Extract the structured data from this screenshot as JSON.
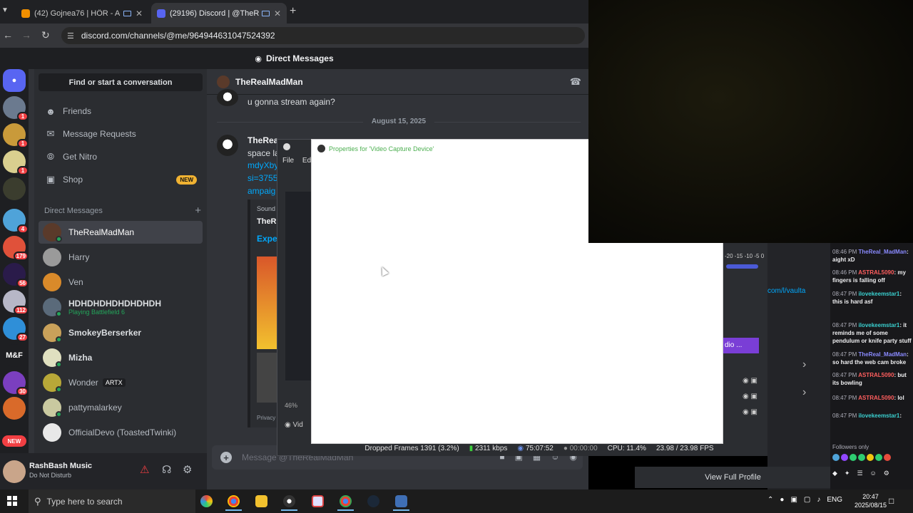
{
  "browser": {
    "tabs": [
      {
        "label": "(42) Gojnea76 | HÖR - Aug",
        "active": false,
        "favicon_color": "#f29000"
      },
      {
        "label": "(29196) Discord | @TheRea",
        "active": true,
        "favicon_color": "#5865f2"
      }
    ],
    "url": "discord.com/channels/@me/964944631047524392"
  },
  "discord": {
    "title": "Direct Messages",
    "find_placeholder": "Find or start a conversation",
    "nav": [
      {
        "label": "Friends",
        "icon": "person-wave-icon"
      },
      {
        "label": "Message Requests",
        "icon": "envelope-icon"
      },
      {
        "label": "Get Nitro",
        "icon": "nitro-icon"
      },
      {
        "label": "Shop",
        "icon": "shop-icon",
        "badge": "NEW"
      }
    ],
    "servers": [
      {
        "badge": "1"
      },
      {
        "badge": "1"
      },
      {
        "badge": "1"
      },
      {
        "badge": ""
      },
      {
        "badge": "4"
      },
      {
        "badge": "179"
      },
      {
        "badge": "56"
      },
      {
        "badge": "112"
      },
      {
        "badge": "27"
      },
      {
        "label": "M&F",
        "badge": ""
      },
      {
        "badge": "30"
      },
      {
        "badge": ""
      }
    ],
    "server_new_label": "NEW",
    "dm_header": "Direct Messages",
    "dms": [
      {
        "name": "TheRealMadMan",
        "active": true
      },
      {
        "name": "Harry"
      },
      {
        "name": "Ven"
      },
      {
        "name": "HDHDHDHDHDHDHDH",
        "status": "Playing Battlefield 6"
      },
      {
        "name": "SmokeyBerserker"
      },
      {
        "name": "Mizha"
      },
      {
        "name": "Wonder",
        "tag": "ARTX"
      },
      {
        "name": "pattymalarkey"
      },
      {
        "name": "OfficialDevo (ToastedTwinki)"
      }
    ],
    "user": {
      "name": "RashBash Music",
      "status": "Do Not Disturb"
    },
    "chat": {
      "recipient": "TheRealMadMan",
      "message_1": "u gonna stream again?",
      "date_separator": "August 15, 2025",
      "author": "TheRea",
      "partial_lines": [
        "space la",
        "mdyXby",
        "si=3755",
        "ampaig"
      ],
      "embed_source": "Sound",
      "embed_title": "TheRe",
      "embed_link": "Expe",
      "embed_footer": "Privacy",
      "composer_placeholder": "Message @TheRealMadMan"
    },
    "view_profile": "View Full Profile"
  },
  "obs": {
    "menu_file": "File",
    "menu_edit": "Ed",
    "zoom": "46%",
    "source": "Vid",
    "properties_title": "Properties for 'Video Capture Device'",
    "status": {
      "dropped": "Dropped Frames 1391 (3.2%)",
      "bitrate": "2311 kbps",
      "stream_time": "75:07:52",
      "rec_time": "00:00:00",
      "cpu": "CPU: 11.4%",
      "fps": "23.98 / 23.98 FPS"
    },
    "meter_ticks": "-20 -15 -10 -5 0",
    "audio_label": "dio ...",
    "right_link": "com/l/vaulta"
  },
  "twitch_chat": {
    "messages": [
      {
        "time": "08:46 PM",
        "user": "TheReal_MadMan",
        "text": "aight xD"
      },
      {
        "time": "08:46 PM",
        "user": "ASTRAL5090",
        "text": "my fingers is falling off"
      },
      {
        "time": "08:47 PM",
        "user": "ilovekeemstar1",
        "text": "this is hard asf"
      },
      {
        "time": "08:47 PM",
        "user": "ilovekeemstar1",
        "text": "it reminds me of some pendulum or knife party stuff"
      },
      {
        "time": "08:47 PM",
        "user": "TheReal_MadMan",
        "text": "so hard the web cam broke"
      },
      {
        "time": "08:47 PM",
        "user": "ASTRAL5090",
        "text": "but its bowling"
      },
      {
        "time": "08:47 PM",
        "user": "ASTRAL5090",
        "text": "lol"
      },
      {
        "time": "08:47 PM",
        "user": "ilovekeemstar1",
        "text": ""
      }
    ],
    "footer": "Followers only"
  },
  "taskbar": {
    "search_placeholder": "Type here to search",
    "lang": "ENG",
    "time": "20:47",
    "date": "2025/08/15"
  }
}
